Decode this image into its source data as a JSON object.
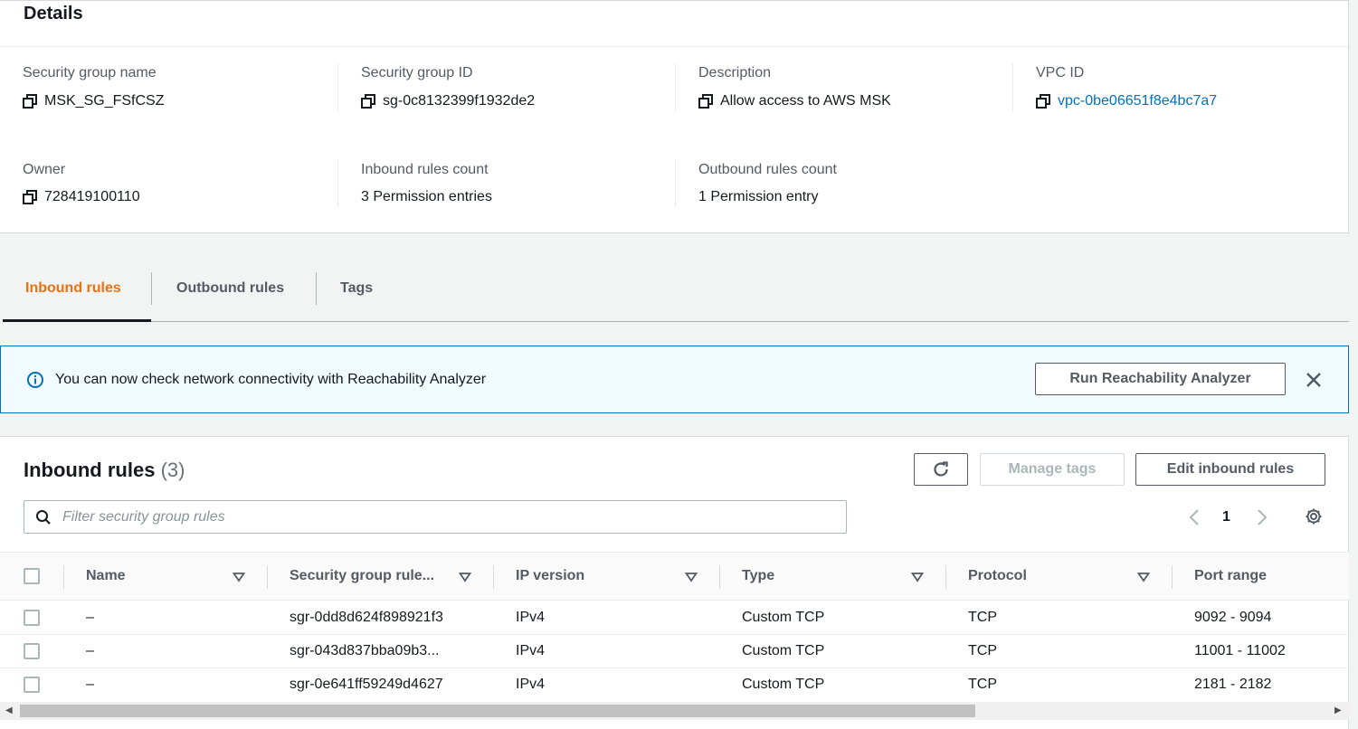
{
  "details": {
    "title": "Details",
    "fields": {
      "sg_name": {
        "label": "Security group name",
        "value": "MSK_SG_FSfCSZ"
      },
      "sg_id": {
        "label": "Security group ID",
        "value": "sg-0c8132399f1932de2"
      },
      "description": {
        "label": "Description",
        "value": "Allow access to AWS MSK"
      },
      "vpc_id": {
        "label": "VPC ID",
        "value": "vpc-0be06651f8e4bc7a7"
      },
      "owner": {
        "label": "Owner",
        "value": "728419100110"
      },
      "inbound_count": {
        "label": "Inbound rules count",
        "value": "3 Permission entries"
      },
      "outbound_count": {
        "label": "Outbound rules count",
        "value": "1 Permission entry"
      }
    }
  },
  "tabs": [
    {
      "label": "Inbound rules",
      "active": true
    },
    {
      "label": "Outbound rules",
      "active": false
    },
    {
      "label": "Tags",
      "active": false
    }
  ],
  "alert": {
    "message": "You can now check network connectivity with Reachability Analyzer",
    "button": "Run Reachability Analyzer"
  },
  "rules": {
    "title": "Inbound rules",
    "count": "(3)",
    "buttons": {
      "manage_tags": "Manage tags",
      "edit": "Edit inbound rules"
    },
    "filter_placeholder": "Filter security group rules",
    "page": "1",
    "columns": [
      "Name",
      "Security group rule...",
      "IP version",
      "Type",
      "Protocol",
      "Port range"
    ],
    "rows": [
      {
        "name": "–",
        "rule_id": "sgr-0dd8d624f898921f3",
        "ip_version": "IPv4",
        "type": "Custom TCP",
        "protocol": "TCP",
        "port_range": "9092 - 9094"
      },
      {
        "name": "–",
        "rule_id": "sgr-043d837bba09b3...",
        "ip_version": "IPv4",
        "type": "Custom TCP",
        "protocol": "TCP",
        "port_range": "11001 - 11002"
      },
      {
        "name": "–",
        "rule_id": "sgr-0e641ff59249d4627",
        "ip_version": "IPv4",
        "type": "Custom TCP",
        "protocol": "TCP",
        "port_range": "2181 - 2182"
      }
    ]
  },
  "colors": {
    "accent": "#ec7211",
    "link": "#0073bb",
    "info_bg": "#f1faff"
  }
}
